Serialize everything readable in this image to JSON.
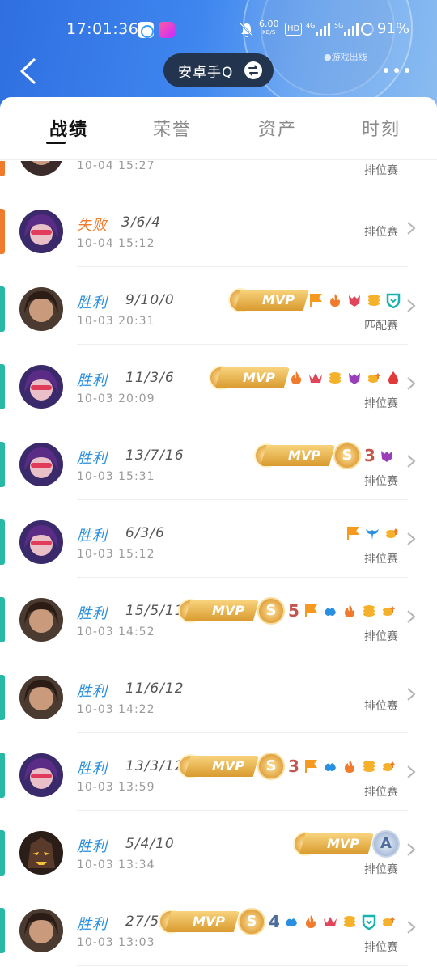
{
  "status_bar": {
    "time": "17:01:36",
    "net_speed": "6.00",
    "net_unit": "KB/S",
    "hd": "HD",
    "signal1": "4G",
    "signal2": "5G",
    "battery": "91%"
  },
  "header": {
    "account": "安卓手Q",
    "corner_text": "●游戏出线"
  },
  "tabs": [
    {
      "label": "战绩",
      "active": true
    },
    {
      "label": "荣誉",
      "active": false
    },
    {
      "label": "资产",
      "active": false
    },
    {
      "label": "时刻",
      "active": false
    }
  ],
  "matches": [
    {
      "result": "",
      "kda": "",
      "date": "10-04 15:27",
      "mode": "排位赛",
      "outcome": "lose"
    },
    {
      "result": "失败",
      "kda": "3/6/4",
      "date": "10-04 15:12",
      "mode": "排位赛",
      "outcome": "lose"
    },
    {
      "result": "胜利",
      "kda": "9/10/0",
      "date": "10-03 20:31",
      "mode": "匹配赛",
      "outcome": "win"
    },
    {
      "result": "胜利",
      "kda": "11/3/6",
      "date": "10-03 20:09",
      "mode": "排位赛",
      "outcome": "win"
    },
    {
      "result": "胜利",
      "kda": "13/7/16",
      "date": "10-03 15:31",
      "mode": "排位赛",
      "outcome": "win"
    },
    {
      "result": "胜利",
      "kda": "6/3/6",
      "date": "10-03 15:12",
      "mode": "排位赛",
      "outcome": "win"
    },
    {
      "result": "胜利",
      "kda": "15/5/11",
      "date": "10-03 14:52",
      "mode": "排位赛",
      "outcome": "win"
    },
    {
      "result": "胜利",
      "kda": "11/6/12",
      "date": "10-03 14:22",
      "mode": "排位赛",
      "outcome": "win"
    },
    {
      "result": "胜利",
      "kda": "13/3/12",
      "date": "10-03 13:59",
      "mode": "排位赛",
      "outcome": "win"
    },
    {
      "result": "胜利",
      "kda": "5/4/10",
      "date": "10-03 13:34",
      "mode": "排位赛",
      "outcome": "win"
    },
    {
      "result": "胜利",
      "kda": "27/5/",
      "date": "10-03 13:03",
      "mode": "排位赛",
      "outcome": "win"
    }
  ],
  "badges": {
    "mvp": "MVP",
    "s": "S",
    "a": "A",
    "num3": "3",
    "num5": "5",
    "num4": "4"
  },
  "colors": {
    "win": "#27b9a6",
    "lose": "#f07b2d",
    "win_text": "#2a8fe0",
    "pill": "#23344e"
  }
}
